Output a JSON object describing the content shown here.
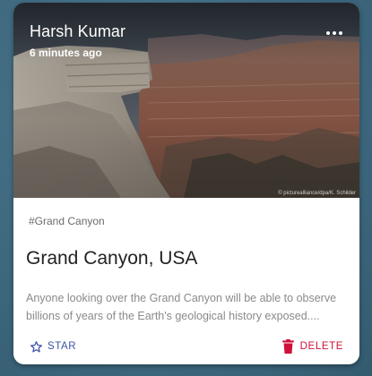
{
  "card": {
    "author": "Harsh Kumar",
    "time": "6 minutes ago",
    "photo_credit": "© picturealliance/dpa/K. Schilder",
    "tag": "#Grand Canyon",
    "title": "Grand Canyon, USA",
    "description": "Anyone looking over the Grand Canyon will be able to observe billions of years of the Earth's geological history exposed....",
    "actions": {
      "star_label": "STAR",
      "delete_label": "DELETE"
    }
  },
  "icons": {
    "menu": "more-horizontal-icon",
    "star": "star-outline-icon",
    "delete": "trash-icon"
  },
  "colors": {
    "star_accent": "#3d52a8",
    "delete_accent": "#d0103a",
    "background": "#3f6a80"
  }
}
